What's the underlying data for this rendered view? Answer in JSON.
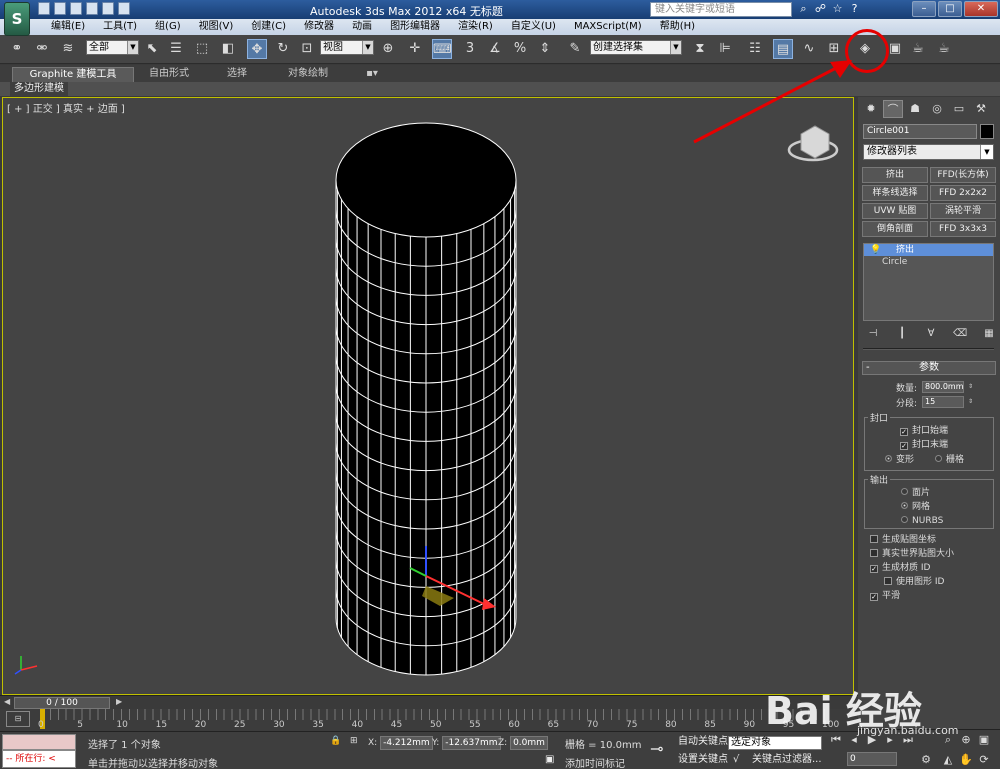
{
  "app": {
    "window_title": "Autodesk 3ds Max  2012 x64      无标题",
    "search_placeholder": "键入关键字或短语",
    "logo_letter": "S"
  },
  "menu": [
    "编辑(E)",
    "工具(T)",
    "组(G)",
    "视图(V)",
    "创建(C)",
    "修改器",
    "动画",
    "图形编辑器",
    "渲染(R)",
    "自定义(U)",
    "MAXScript(M)",
    "帮助(H)"
  ],
  "toolbar": {
    "selection_filter": "全部",
    "ref_coord": "视图",
    "named_selection": "创建选择集"
  },
  "ribbon": {
    "tabs": [
      "Graphite 建模工具",
      "自由形式",
      "选择",
      "对象绘制"
    ],
    "sub_label": "多边形建模"
  },
  "viewport": {
    "label": "[ + ] 正交 ] 真实 + 边面 ]"
  },
  "command_panel": {
    "object_name": "Circle001",
    "modifier_list": "修改器列表",
    "modifier_buttons": [
      "挤出",
      "FFD(长方体)",
      "样条线选择",
      "FFD 2x2x2",
      "UVW 贴图",
      "涡轮平滑",
      "倒角剖面",
      "FFD 3x3x3"
    ],
    "stack": {
      "selected": "挤出",
      "base": "Circle"
    },
    "params": {
      "title": "参数",
      "amount_label": "数量:",
      "amount_value": "800.0mm",
      "segments_label": "分段:",
      "segments_value": "15",
      "capping_title": "封口",
      "cap_start": "封口始端",
      "cap_end": "封口末端",
      "morph": "变形",
      "grid": "栅格",
      "output_title": "输出",
      "patch": "面片",
      "mesh": "网格",
      "nurbs": "NURBS",
      "gen_mapping": "生成贴图坐标",
      "real_world": "真实世界贴图大小",
      "gen_mat_ids": "生成材质 ID",
      "use_shape_ids": "使用图形 ID",
      "smooth": "平滑"
    }
  },
  "timeline": {
    "frame_display": "0 / 100",
    "ticks": [
      "0",
      "5",
      "10",
      "15",
      "20",
      "25",
      "30",
      "35",
      "40",
      "45",
      "50",
      "55",
      "60",
      "65",
      "70",
      "75",
      "80",
      "85",
      "90",
      "95",
      "100"
    ]
  },
  "status": {
    "maxscript_prompt": "所在行:",
    "selection": "选择了 1 个对象",
    "prompt": "单击并拖动以选择并移动对象",
    "x_label": "X:",
    "x_value": "-4.212mm",
    "y_label": "Y:",
    "y_value": "-12.637mm",
    "z_label": "Z:",
    "z_value": "0.0mm",
    "grid": "栅格 = 10.0mm",
    "add_time_tag": "添加时间标记",
    "auto_key": "自动关键点",
    "set_key": "设置关键点",
    "selected_obj": "选定对象",
    "key_filters": "关键点过滤器...",
    "frame": "0"
  },
  "watermark": {
    "brand": "Bai 经验",
    "url": "jingyan.baidu.com"
  },
  "colors": {
    "viewport_bg": "#444444",
    "selection_border": "#c0c000",
    "annotation_red": "#e60000",
    "stack_highlight": "#5e8fd9"
  }
}
